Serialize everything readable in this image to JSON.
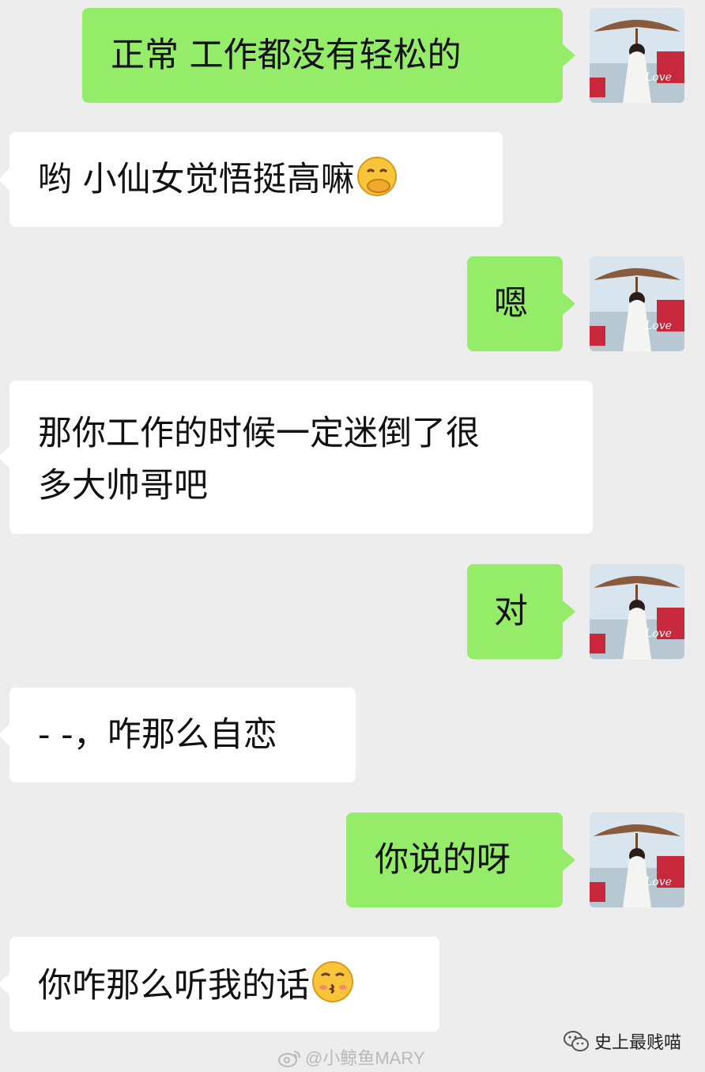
{
  "chat": {
    "messages": [
      {
        "side": "out",
        "text": "正常  工作都没有轻松的"
      },
      {
        "side": "in",
        "text": "哟  小仙女觉悟挺高嘛",
        "emoji": "hand-over-mouth-emoji"
      },
      {
        "side": "out",
        "text": "嗯"
      },
      {
        "side": "in",
        "lines": [
          "那你工作的时候一定迷倒了很",
          "多大帅哥吧"
        ]
      },
      {
        "side": "out",
        "text": "对"
      },
      {
        "side": "in",
        "text": "- -，咋那么自恋"
      },
      {
        "side": "out",
        "text": "你说的呀"
      },
      {
        "side": "in",
        "text": "你咋那么听我的话",
        "emoji": "kissing-emoji"
      }
    ]
  },
  "avatar": {
    "icon": "user-avatar-photo",
    "overlay_text": "Love"
  },
  "watermarks": {
    "weibo": "@小鲸鱼MARY",
    "weibo_icon": "weibo-icon",
    "wechat_icon": "wechat-icon",
    "wechat": "史上最贱喵"
  },
  "colors": {
    "background": "#ededed",
    "outgoing_bubble": "#95ec69",
    "incoming_bubble": "#ffffff"
  }
}
